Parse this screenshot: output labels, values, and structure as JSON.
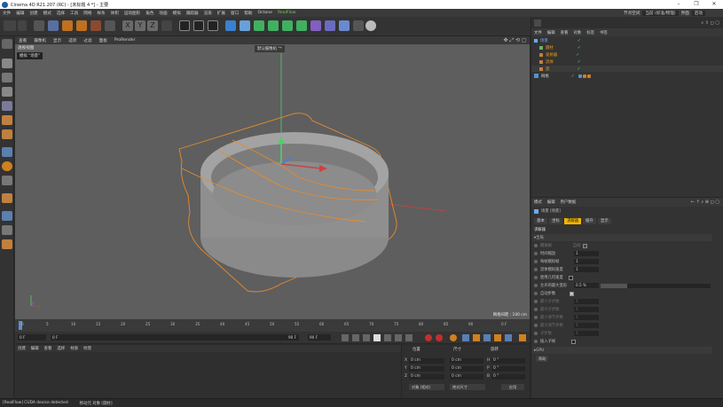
{
  "window": {
    "title": "Cinema 4D R21.207 (RC) - [未标题 4 *] - 主要"
  },
  "menubar": {
    "items": [
      "文件",
      "编辑",
      "创建",
      "模式",
      "选择",
      "工具",
      "网格",
      "样条",
      "体积",
      "运动图形",
      "角色",
      "动画",
      "模拟",
      "跟踪器",
      "渲染",
      "扩展",
      "窗口",
      "帮助",
      "Octane",
      "RealFlow"
    ],
    "right_items": [
      "节点空间",
      "当前 (标准/物理)",
      "界面",
      "启动"
    ]
  },
  "viewport": {
    "menu": [
      "查看",
      "摄像机",
      "显示",
      "选项",
      "过滤",
      "面板",
      "ProRender"
    ],
    "label": "透视视图",
    "tooltip": "模拟 \"场景\"",
    "camera": "默认摄像机 °*",
    "grid_info": "网格间距 : 100 cm"
  },
  "timeline": {
    "ticks": [
      "0",
      "5",
      "10",
      "15",
      "20",
      "25",
      "30",
      "35",
      "40",
      "45",
      "50",
      "55",
      "60",
      "65",
      "70",
      "75",
      "80",
      "85",
      "90"
    ],
    "end_label": "0 F"
  },
  "transport": {
    "current": "0 F",
    "start": "0 F",
    "end": "90 F",
    "end2": "90 F"
  },
  "material_panel": {
    "menu": [
      "创建",
      "编辑",
      "查看",
      "选择",
      "材质",
      "纹理"
    ]
  },
  "coordinates": {
    "headers": [
      "位置",
      "尺寸",
      "旋转"
    ],
    "rows": [
      {
        "axis": "X",
        "pos": "0 cm",
        "size": "0 cm",
        "rot_label": "H",
        "rot": "0 °"
      },
      {
        "axis": "Y",
        "pos": "0 cm",
        "size": "0 cm",
        "rot_label": "P",
        "rot": "0 °"
      },
      {
        "axis": "Z",
        "pos": "0 cm",
        "size": "0 cm",
        "rot_label": "B",
        "rot": "0 °"
      }
    ],
    "mode1": "对象 (相对)",
    "mode2": "绝对尺寸",
    "apply": "应用"
  },
  "object_manager": {
    "menu": [
      "文件",
      "编辑",
      "查看",
      "对象",
      "标签",
      "书签"
    ],
    "objects": [
      {
        "name": "场景",
        "color": "#6fa8ff",
        "indent": 0
      },
      {
        "name": "圆柱",
        "color": "#f0a020",
        "indent": 1
      },
      {
        "name": "发射器",
        "color": "#f0a020",
        "indent": 1
      },
      {
        "name": "流体",
        "color": "#f0a020",
        "indent": 1
      },
      {
        "name": "流",
        "color": "#f0a020",
        "indent": 1
      },
      {
        "name": "网格",
        "color": "#cfcfcf",
        "indent": 0
      }
    ]
  },
  "attribute_manager": {
    "menu": [
      "模式",
      "编辑",
      "用户数据"
    ],
    "object_label": "场景 [场景]",
    "tabs": [
      "基本",
      "坐标",
      "求解器",
      "缓存",
      "显示"
    ],
    "active_tab": "求解器",
    "section": "求解器",
    "subsection": "全局",
    "fields": [
      {
        "label": "模拟帧",
        "value": "",
        "extra": "自动",
        "checked": true,
        "disabled": true
      },
      {
        "label": "时间缩放",
        "value": "1"
      },
      {
        "label": "每帧模拟帧",
        "value": "1"
      },
      {
        "label": "流体模拟速度",
        "value": "1"
      },
      {
        "label": "使用几何速度",
        "value": "",
        "checkbox": true
      },
      {
        "label": "允许的最大变形",
        "value": "0.5 %"
      },
      {
        "label": "自动步数",
        "value": "",
        "checkbox": true,
        "checked": true
      },
      {
        "label": "最小子步数",
        "value": "1",
        "disabled": true
      },
      {
        "label": "最大子步数",
        "value": "1",
        "disabled": true
      },
      {
        "label": "最小调节步数",
        "value": "1",
        "disabled": true
      },
      {
        "label": "最大调节步数",
        "value": "1",
        "disabled": true
      },
      {
        "label": "子步数",
        "value": "1",
        "disabled": true
      },
      {
        "label": "插入子帧",
        "value": "",
        "checkbox": true
      }
    ],
    "gpu_section": "GPU",
    "help_button": "帮助"
  },
  "status": {
    "message": "[RealFlow] CUDA device detected",
    "hint": "移动元 对象 [圆柱]"
  }
}
